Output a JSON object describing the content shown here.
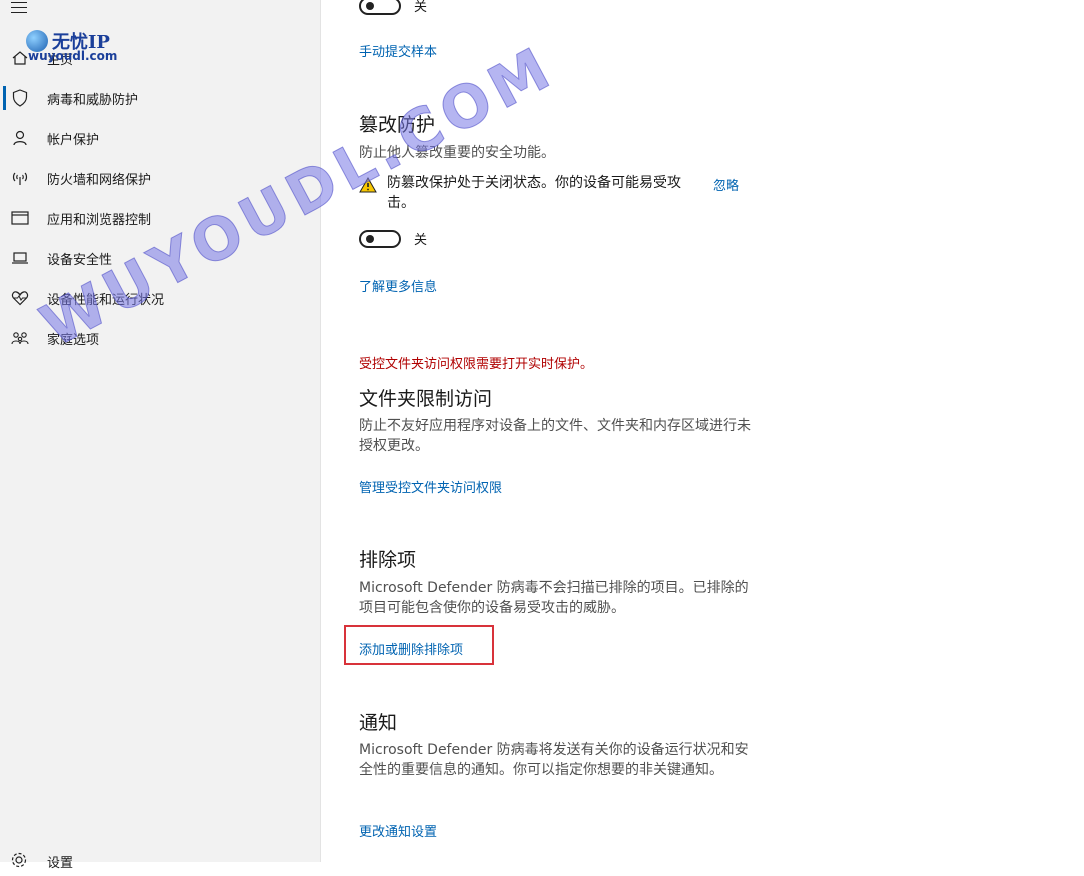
{
  "sidebar": {
    "items": [
      {
        "label": "主页",
        "icon": "home-icon"
      },
      {
        "label": "病毒和威胁防护",
        "icon": "shield-icon"
      },
      {
        "label": "帐户保护",
        "icon": "person-icon"
      },
      {
        "label": "防火墙和网络保护",
        "icon": "wifi-antenna-icon"
      },
      {
        "label": "应用和浏览器控制",
        "icon": "window-icon"
      },
      {
        "label": "设备安全性",
        "icon": "laptop-icon"
      },
      {
        "label": "设备性能和运行状况",
        "icon": "heart-pulse-icon"
      },
      {
        "label": "家庭选项",
        "icon": "family-icon"
      }
    ],
    "settings_label": "设置"
  },
  "top_toggle": {
    "state_label": "关"
  },
  "manual_submit_link": "手动提交样本",
  "tamper": {
    "title": "篡改防护",
    "desc": "防止他人篡改重要的安全功能。",
    "warning": "防篡改保护处于关闭状态。你的设备可能易受攻击。",
    "ignore_link": "忽略",
    "toggle_label": "关",
    "learn_more_link": "了解更多信息"
  },
  "folder": {
    "notice": "受控文件夹访问权限需要打开实时保护。",
    "title": "文件夹限制访问",
    "desc": "防止不友好应用程序对设备上的文件、文件夹和内存区域进行未授权更改。",
    "manage_link": "管理受控文件夹访问权限"
  },
  "exclusions": {
    "title": "排除项",
    "desc": "Microsoft Defender 防病毒不会扫描已排除的项目。已排除的项目可能包含使你的设备易受攻击的威胁。",
    "add_remove_link": "添加或删除排除项"
  },
  "notifications": {
    "title": "通知",
    "desc": "Microsoft Defender 防病毒将发送有关你的设备运行状况和安全性的重要信息的通知。你可以指定你想要的非关键通知。",
    "change_link": "更改通知设置"
  },
  "watermark": {
    "logo_text": "无忧IP",
    "url_text": "wuyoudl.com",
    "big_text": "WUYOUDL.COM"
  },
  "colors": {
    "accent": "#0063b1",
    "warning_red": "#b00000",
    "highlight_box": "#d8323a"
  }
}
